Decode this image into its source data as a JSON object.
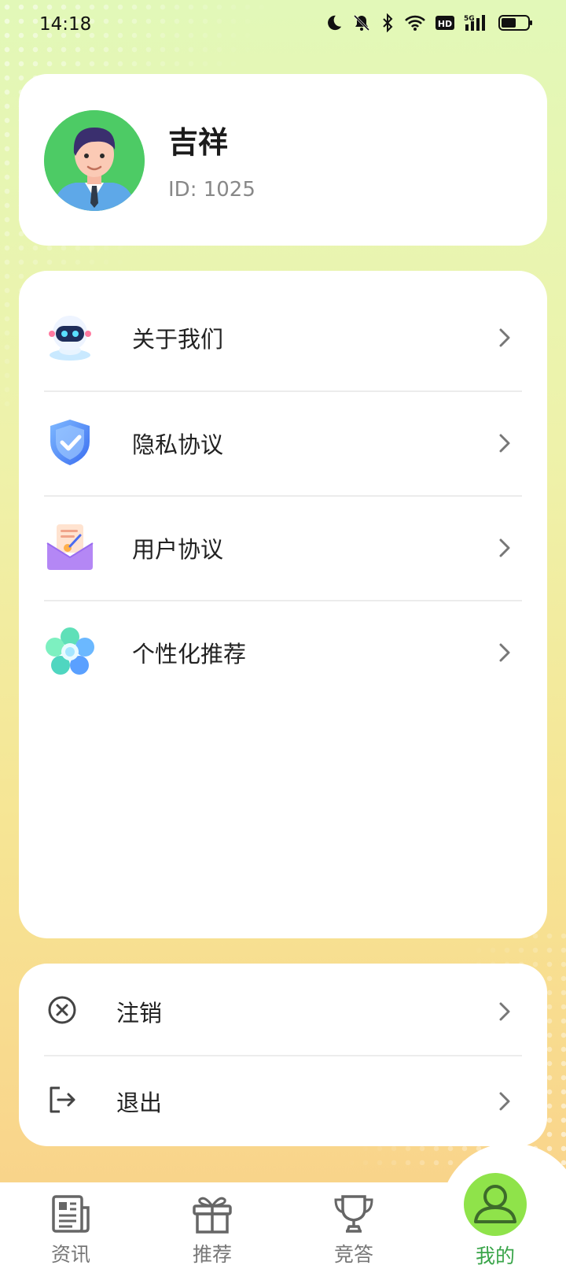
{
  "status_bar": {
    "time": "14:18",
    "icons": [
      "moon-icon",
      "bell-off-icon",
      "bluetooth-icon",
      "wifi-icon",
      "hd-icon",
      "5g-signal-icon",
      "battery-icon"
    ],
    "network": "5G",
    "hd": "HD"
  },
  "profile": {
    "name": "吉祥",
    "id_text": "ID: 1025",
    "avatar_color": "#4dcb65"
  },
  "menu": {
    "items": [
      {
        "label": "关于我们",
        "icon": "robot-icon"
      },
      {
        "label": "隐私协议",
        "icon": "shield-check-icon"
      },
      {
        "label": "用户协议",
        "icon": "envelope-document-icon"
      },
      {
        "label": "个性化推荐",
        "icon": "flower-icon"
      }
    ]
  },
  "actions": {
    "items": [
      {
        "label": "注销",
        "icon": "circle-x-icon"
      },
      {
        "label": "退出",
        "icon": "logout-icon"
      }
    ]
  },
  "tabs": {
    "items": [
      {
        "label": "资讯",
        "icon": "newspaper-icon",
        "active": false
      },
      {
        "label": "推荐",
        "icon": "gift-icon",
        "active": false
      },
      {
        "label": "竞答",
        "icon": "trophy-icon",
        "active": false
      },
      {
        "label": "我的",
        "icon": "user-icon",
        "active": true
      }
    ],
    "active_color": "#3aa54a",
    "active_bg": "#8fe34a"
  }
}
